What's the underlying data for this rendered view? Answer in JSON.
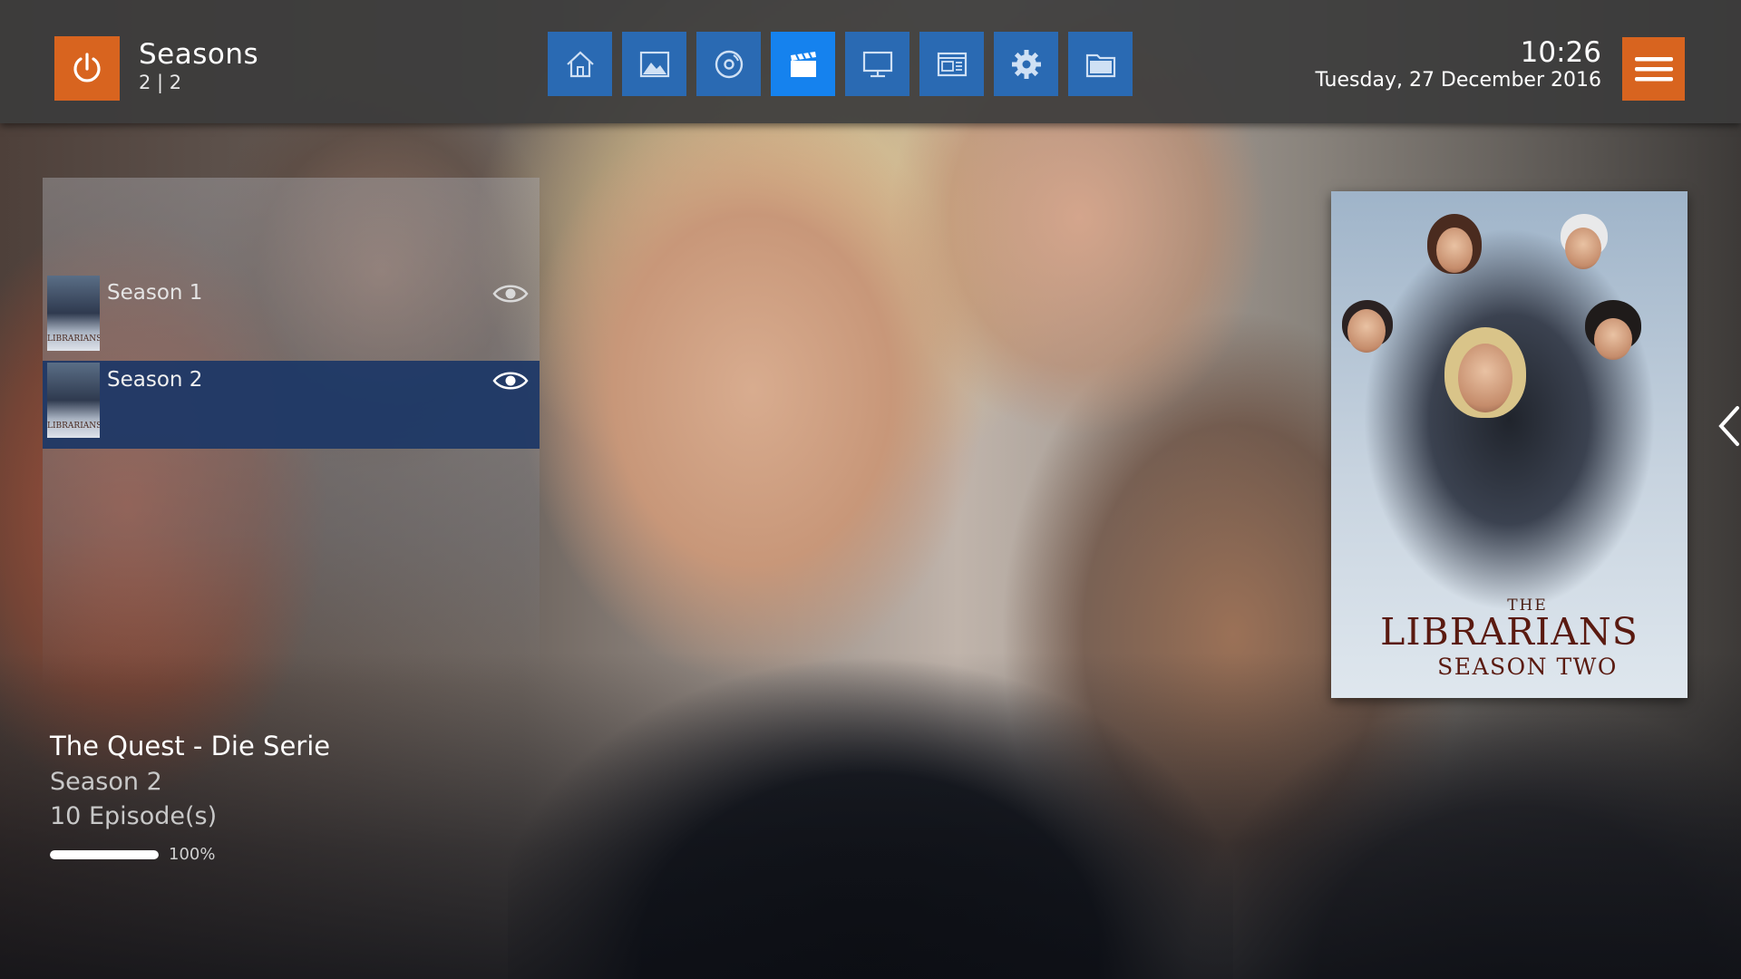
{
  "header": {
    "title": "Seasons",
    "count": "2 | 2",
    "time": "10:26",
    "date": "Tuesday, 27 December 2016"
  },
  "nav": {
    "items": [
      {
        "icon": "home-icon"
      },
      {
        "icon": "pictures-icon"
      },
      {
        "icon": "music-icon"
      },
      {
        "icon": "videos-icon",
        "active": true
      },
      {
        "icon": "tv-icon"
      },
      {
        "icon": "programs-icon"
      },
      {
        "icon": "settings-icon"
      },
      {
        "icon": "files-icon"
      }
    ]
  },
  "list": {
    "items": [
      {
        "label": "Season 1",
        "watched": true,
        "focused": false
      },
      {
        "label": "Season 2",
        "watched": true,
        "focused": true
      }
    ]
  },
  "info": {
    "show_title": "The Quest - Die Serie",
    "season": "Season 2",
    "episodes": "10 Episode(s)",
    "progress_percent": 100,
    "progress_text": "100%"
  },
  "poster": {
    "the": "THE",
    "title": "LIBRARIANS",
    "subtitle": "SEASON TWO"
  },
  "colors": {
    "accent_orange": "#d8641f",
    "nav_blue": "#2a6ab3",
    "nav_active_blue": "#1582ee",
    "focus_row": "#1c3766"
  }
}
